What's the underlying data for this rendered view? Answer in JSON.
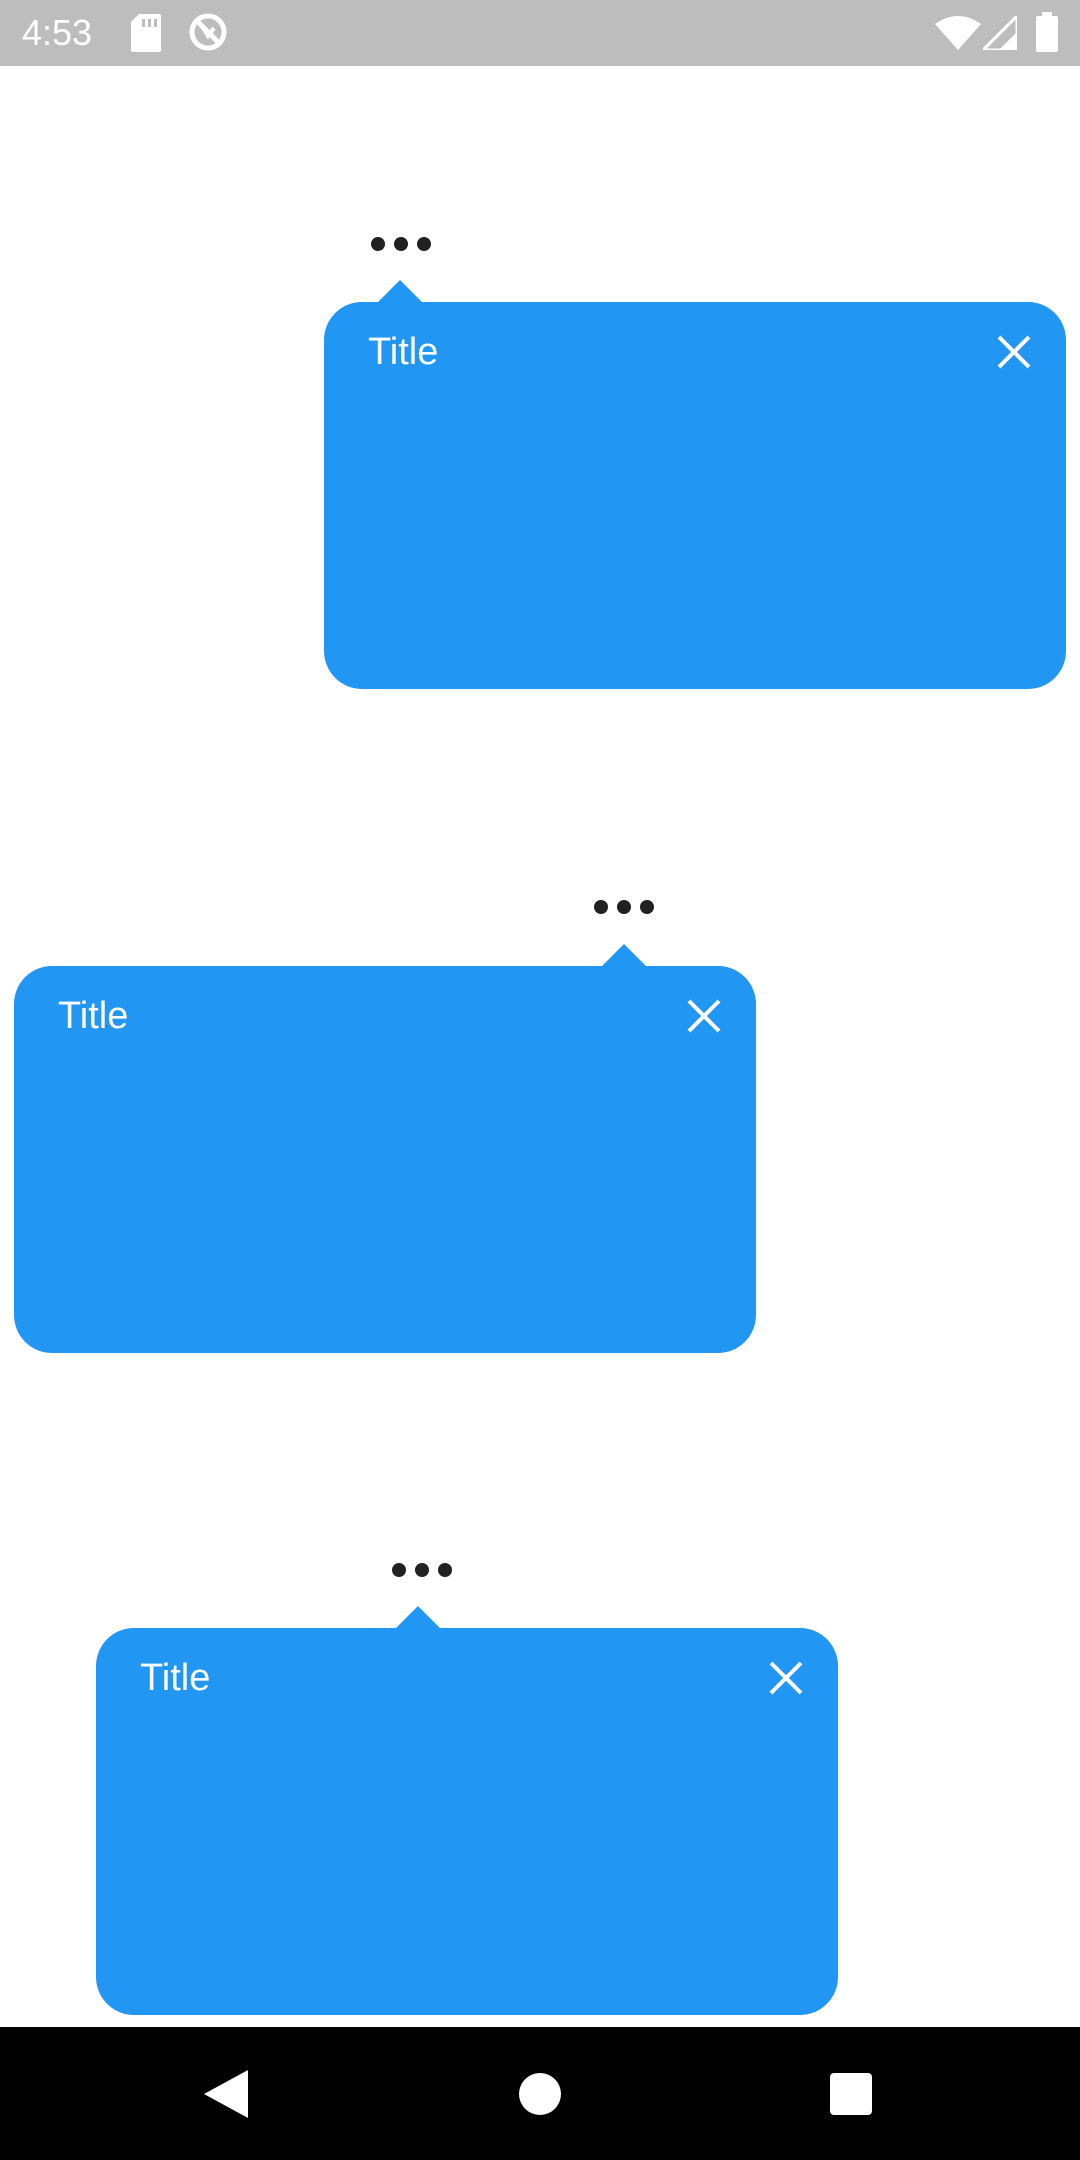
{
  "status_bar": {
    "time": "4:53",
    "icons": [
      "sd-card-icon",
      "sync-disabled-icon",
      "wifi-icon",
      "signal-icon",
      "battery-icon"
    ]
  },
  "popups": [
    {
      "title": "Title",
      "close_icon": "close-icon",
      "anchor_icon": "more-horizontal-icon",
      "color": "#2196f3"
    },
    {
      "title": "Title",
      "close_icon": "close-icon",
      "anchor_icon": "more-horizontal-icon",
      "color": "#2196f3"
    },
    {
      "title": "Title",
      "close_icon": "close-icon",
      "anchor_icon": "more-horizontal-icon",
      "color": "#2196f3"
    }
  ],
  "nav_bar": {
    "buttons": [
      "back-icon",
      "home-icon",
      "recents-icon"
    ]
  }
}
